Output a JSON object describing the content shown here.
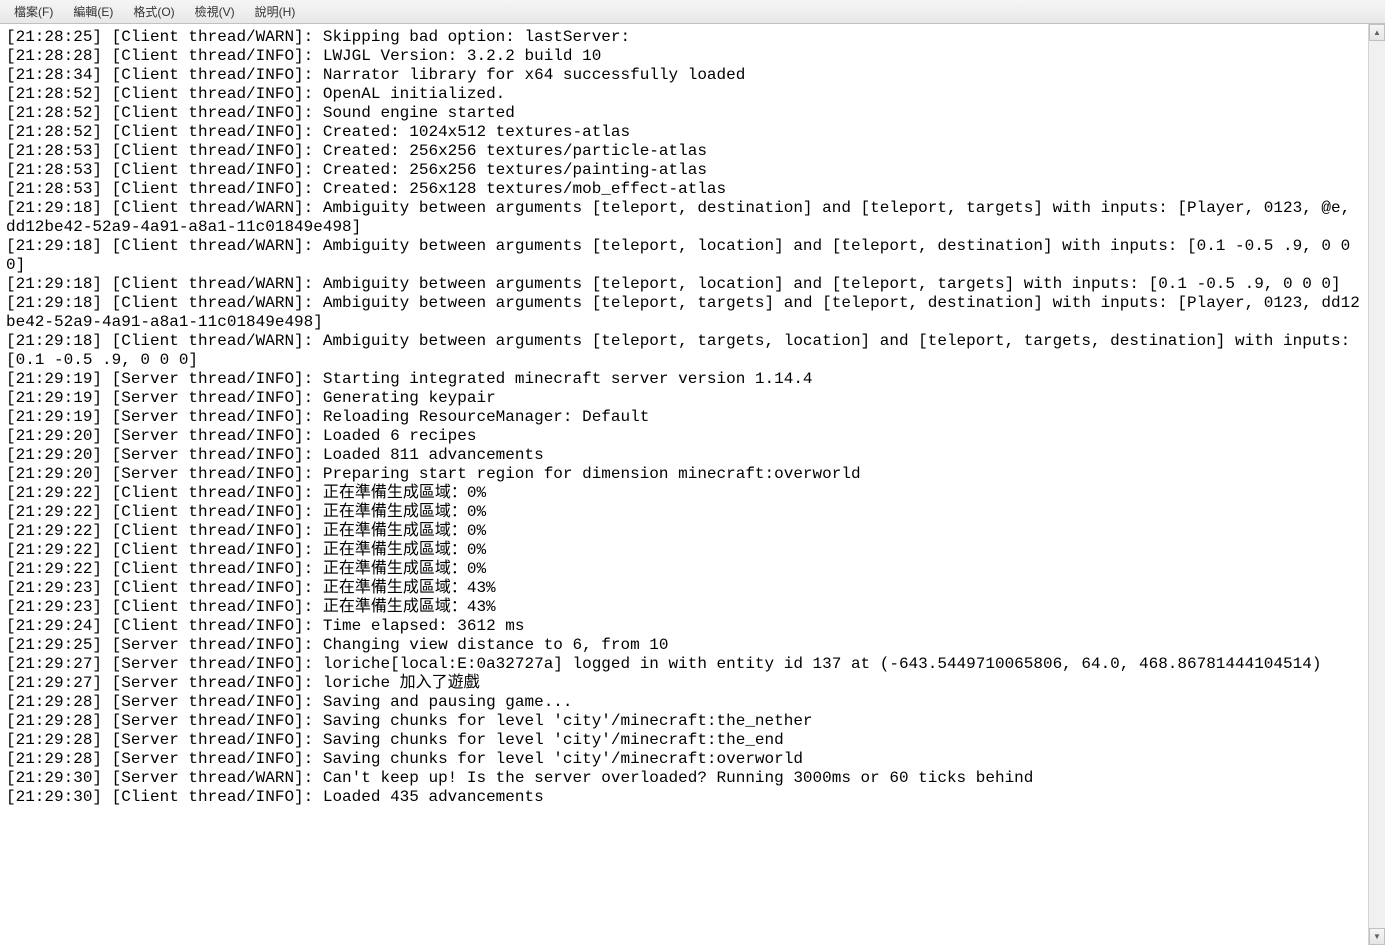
{
  "menubar": {
    "file": "檔案(F)",
    "edit": "編輯(E)",
    "format": "格式(O)",
    "view": "檢視(V)",
    "help": "說明(H)"
  },
  "log_lines": [
    "[21:28:25] [Client thread/WARN]: Skipping bad option: lastServer:",
    "[21:28:28] [Client thread/INFO]: LWJGL Version: 3.2.2 build 10",
    "[21:28:34] [Client thread/INFO]: Narrator library for x64 successfully loaded",
    "[21:28:52] [Client thread/INFO]: OpenAL initialized.",
    "[21:28:52] [Client thread/INFO]: Sound engine started",
    "[21:28:52] [Client thread/INFO]: Created: 1024x512 textures-atlas",
    "[21:28:53] [Client thread/INFO]: Created: 256x256 textures/particle-atlas",
    "[21:28:53] [Client thread/INFO]: Created: 256x256 textures/painting-atlas",
    "[21:28:53] [Client thread/INFO]: Created: 256x128 textures/mob_effect-atlas",
    "[21:29:18] [Client thread/WARN]: Ambiguity between arguments [teleport, destination] and [teleport, targets] with inputs: [Player, 0123, @e, dd12be42-52a9-4a91-a8a1-11c01849e498]",
    "[21:29:18] [Client thread/WARN]: Ambiguity between arguments [teleport, location] and [teleport, destination] with inputs: [0.1 -0.5 .9, 0 0 0]",
    "[21:29:18] [Client thread/WARN]: Ambiguity between arguments [teleport, location] and [teleport, targets] with inputs: [0.1 -0.5 .9, 0 0 0]",
    "[21:29:18] [Client thread/WARN]: Ambiguity between arguments [teleport, targets] and [teleport, destination] with inputs: [Player, 0123, dd12be42-52a9-4a91-a8a1-11c01849e498]",
    "[21:29:18] [Client thread/WARN]: Ambiguity between arguments [teleport, targets, location] and [teleport, targets, destination] with inputs: [0.1 -0.5 .9, 0 0 0]",
    "[21:29:19] [Server thread/INFO]: Starting integrated minecraft server version 1.14.4",
    "[21:29:19] [Server thread/INFO]: Generating keypair",
    "[21:29:19] [Server thread/INFO]: Reloading ResourceManager: Default",
    "[21:29:20] [Server thread/INFO]: Loaded 6 recipes",
    "[21:29:20] [Server thread/INFO]: Loaded 811 advancements",
    "[21:29:20] [Server thread/INFO]: Preparing start region for dimension minecraft:overworld",
    "[21:29:22] [Client thread/INFO]: 正在準備生成區域：0%",
    "[21:29:22] [Client thread/INFO]: 正在準備生成區域：0%",
    "[21:29:22] [Client thread/INFO]: 正在準備生成區域：0%",
    "[21:29:22] [Client thread/INFO]: 正在準備生成區域：0%",
    "[21:29:22] [Client thread/INFO]: 正在準備生成區域：0%",
    "[21:29:23] [Client thread/INFO]: 正在準備生成區域：43%",
    "[21:29:23] [Client thread/INFO]: 正在準備生成區域：43%",
    "[21:29:24] [Client thread/INFO]: Time elapsed: 3612 ms",
    "[21:29:25] [Server thread/INFO]: Changing view distance to 6, from 10",
    "[21:29:27] [Server thread/INFO]: loriche[local:E:0a32727a] logged in with entity id 137 at (-643.5449710065806, 64.0, 468.86781444104514)",
    "[21:29:27] [Server thread/INFO]: loriche 加入了遊戲",
    "[21:29:28] [Server thread/INFO]: Saving and pausing game...",
    "[21:29:28] [Server thread/INFO]: Saving chunks for level 'city'/minecraft:the_nether",
    "[21:29:28] [Server thread/INFO]: Saving chunks for level 'city'/minecraft:the_end",
    "[21:29:28] [Server thread/INFO]: Saving chunks for level 'city'/minecraft:overworld",
    "[21:29:30] [Server thread/WARN]: Can't keep up! Is the server overloaded? Running 3000ms or 60 ticks behind",
    "[21:29:30] [Client thread/INFO]: Loaded 435 advancements"
  ]
}
